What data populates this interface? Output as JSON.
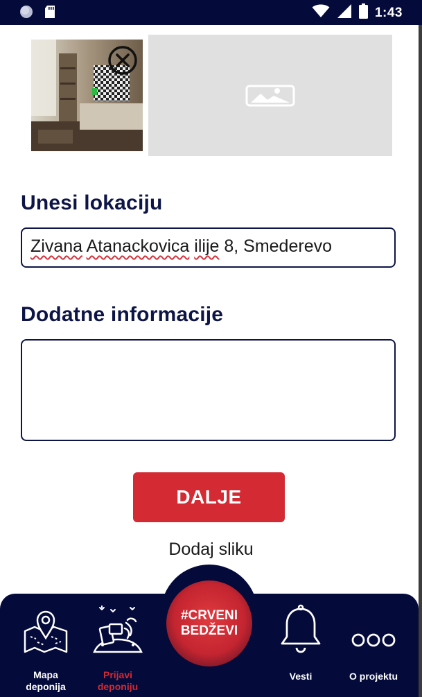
{
  "status_bar": {
    "time": "1:43"
  },
  "form": {
    "location_label": "Unesi lokaciju",
    "location_words": [
      "Zivana",
      "Atanackovica",
      "ilije",
      "8, Smederevo"
    ],
    "info_label": "Dodatne informacije",
    "info_value": "",
    "submit_label": "DALJE",
    "add_photo_label": "Dodaj sliku"
  },
  "nav": {
    "items": [
      {
        "line1": "Mapa",
        "line2": "deponija",
        "icon": "map-pin-icon",
        "active": false
      },
      {
        "line1": "Prijavi",
        "line2": "deponiju",
        "icon": "trash-report-icon",
        "active": true
      },
      {
        "line1": "Vesti",
        "line2": "",
        "icon": "bell-icon",
        "active": false
      },
      {
        "line1": "O projektu",
        "line2": "",
        "icon": "more-dots-icon",
        "active": false
      }
    ],
    "center": {
      "line1": "#CRVENI",
      "line2": "BEDŽEVI"
    }
  },
  "colors": {
    "navy": "#040a3a",
    "accent_red": "#d42a33",
    "placeholder_gray": "#e0e0e0"
  }
}
